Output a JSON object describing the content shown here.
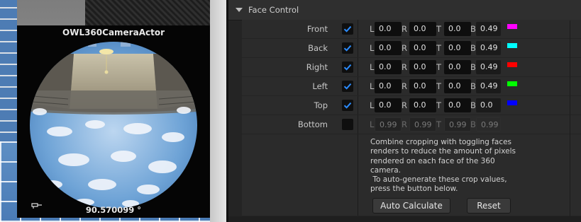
{
  "viewport": {
    "actor_name": "OWL360CameraActor",
    "angle_readout": "90.570099 °"
  },
  "details": {
    "section_title": "Face Control",
    "field_labels": {
      "left": "L",
      "right": "R",
      "top": "T",
      "bottom": "B"
    },
    "faces": [
      {
        "name": "Front",
        "checked": true,
        "L": "0.0",
        "R": "0.0",
        "T": "0.0",
        "B": "0.49",
        "swatch": "#ff00ff"
      },
      {
        "name": "Back",
        "checked": true,
        "L": "0.0",
        "R": "0.0",
        "T": "0.0",
        "B": "0.49",
        "swatch": "#00ffff"
      },
      {
        "name": "Right",
        "checked": true,
        "L": "0.0",
        "R": "0.0",
        "T": "0.0",
        "B": "0.49",
        "swatch": "#ff0000"
      },
      {
        "name": "Left",
        "checked": true,
        "L": "0.0",
        "R": "0.0",
        "T": "0.0",
        "B": "0.49",
        "swatch": "#00ff00"
      },
      {
        "name": "Top",
        "checked": true,
        "L": "0.0",
        "R": "0.0",
        "T": "0.0",
        "B": "0.0",
        "swatch": "#0000ff"
      },
      {
        "name": "Bottom",
        "checked": false,
        "L": "0.99",
        "R": "0.99",
        "T": "0.99",
        "B": "0.99",
        "swatch": ""
      }
    ],
    "info_text": "Combine cropping with toggling faces\nrenders to reduce the amount of pixels\nrendered on each face of the 360\ncamera.\n To auto-generate these crop values,\npress the button below.",
    "auto_calculate_label": "Auto Calculate",
    "reset_label": "Reset"
  },
  "colors": {
    "checkbox_accent": "#2b8cff",
    "panel_bg": "#242424"
  }
}
